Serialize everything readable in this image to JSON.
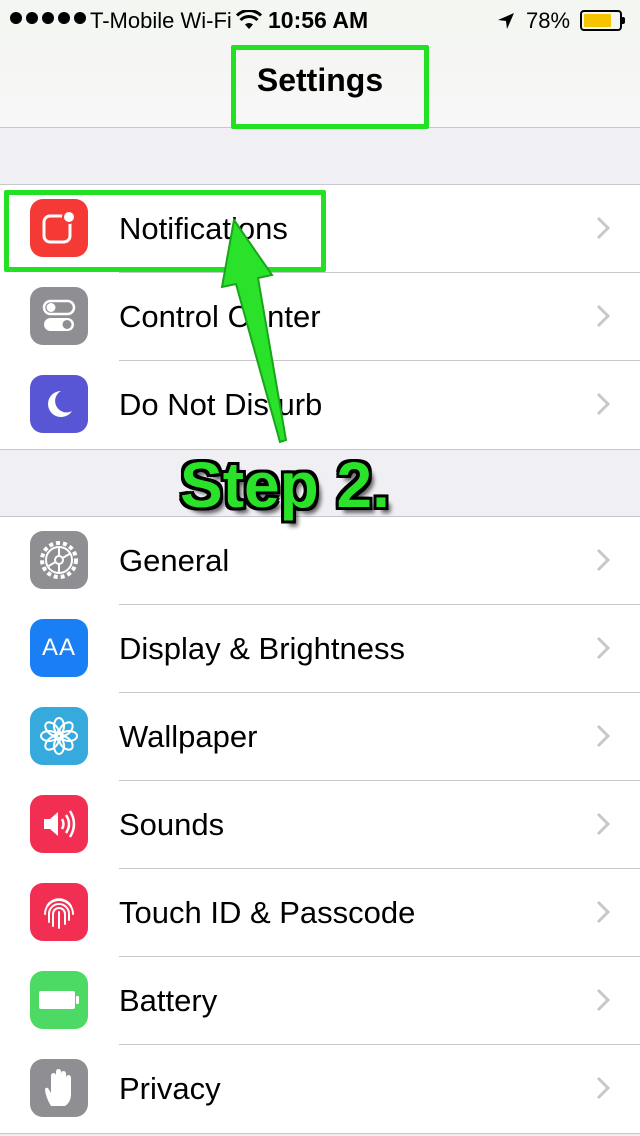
{
  "status_bar": {
    "carrier": "T-Mobile Wi-Fi",
    "time": "10:56 AM",
    "battery_percent": "78%",
    "battery_level": 0.78,
    "battery_color": "#f5c300"
  },
  "nav": {
    "title": "Settings"
  },
  "groups": [
    {
      "items": [
        {
          "label": "Notifications",
          "icon": "notifications-icon",
          "color": "#f53a35"
        },
        {
          "label": "Control Center",
          "icon": "control-center-icon",
          "color": "#8e8e93"
        },
        {
          "label": "Do Not Disturb",
          "icon": "moon-icon",
          "color": "#5956d6"
        }
      ]
    },
    {
      "items": [
        {
          "label": "General",
          "icon": "gear-icon",
          "color": "#8e8e93"
        },
        {
          "label": "Display & Brightness",
          "icon": "text-size-icon",
          "color": "#1a7ef5",
          "icon_text": "AA"
        },
        {
          "label": "Wallpaper",
          "icon": "flower-icon",
          "color": "#36aadc"
        },
        {
          "label": "Sounds",
          "icon": "speaker-icon",
          "color": "#f22e52"
        },
        {
          "label": "Touch ID & Passcode",
          "icon": "fingerprint-icon",
          "color": "#f22e52"
        },
        {
          "label": "Battery",
          "icon": "battery-icon",
          "color": "#4cd964"
        },
        {
          "label": "Privacy",
          "icon": "hand-icon",
          "color": "#8e8e93"
        }
      ]
    }
  ],
  "annotation": {
    "text": "Step 2.",
    "color": "#22e022"
  }
}
